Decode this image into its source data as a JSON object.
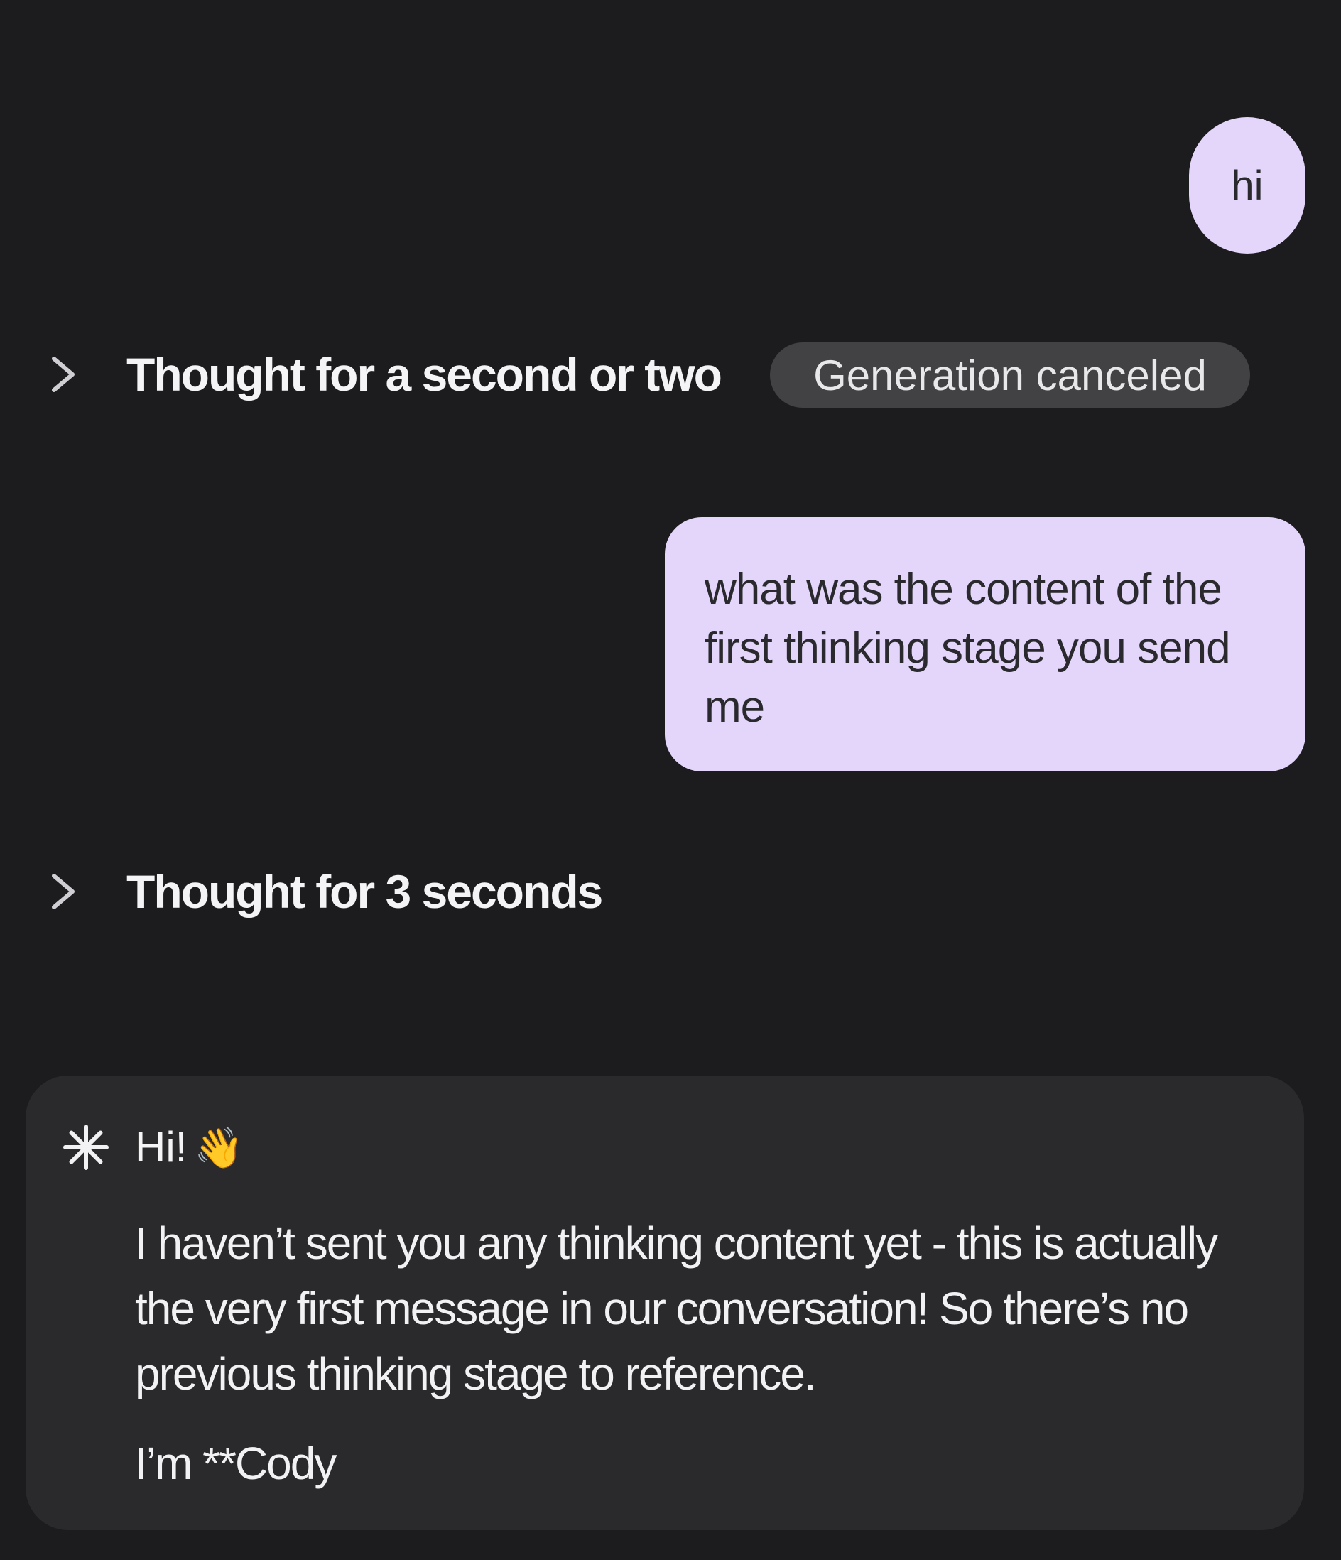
{
  "messages": {
    "user_hi": "hi",
    "thought_1": "Thought for a second or two",
    "generation_status": "Generation canceled",
    "user_question": "what was the content of the first thinking stage you send me",
    "thought_2": "Thought for 3 seconds",
    "assistant": {
      "greeting": "Hi!",
      "greeting_emoji": "👋",
      "body": "I haven’t sent you any thinking content yet - this is actually the very first message in our conversation! So there’s no previous thinking stage to reference.",
      "tail": "I’m **Cody"
    }
  },
  "icons": {
    "thought_toggle": "chevron-right-icon",
    "assistant_avatar": "asterisk-icon"
  },
  "colors": {
    "background": "#1c1c1e",
    "user_bubble": "#e4d6fa",
    "status_pill": "#424244",
    "assistant_card": "#2a2a2c"
  }
}
